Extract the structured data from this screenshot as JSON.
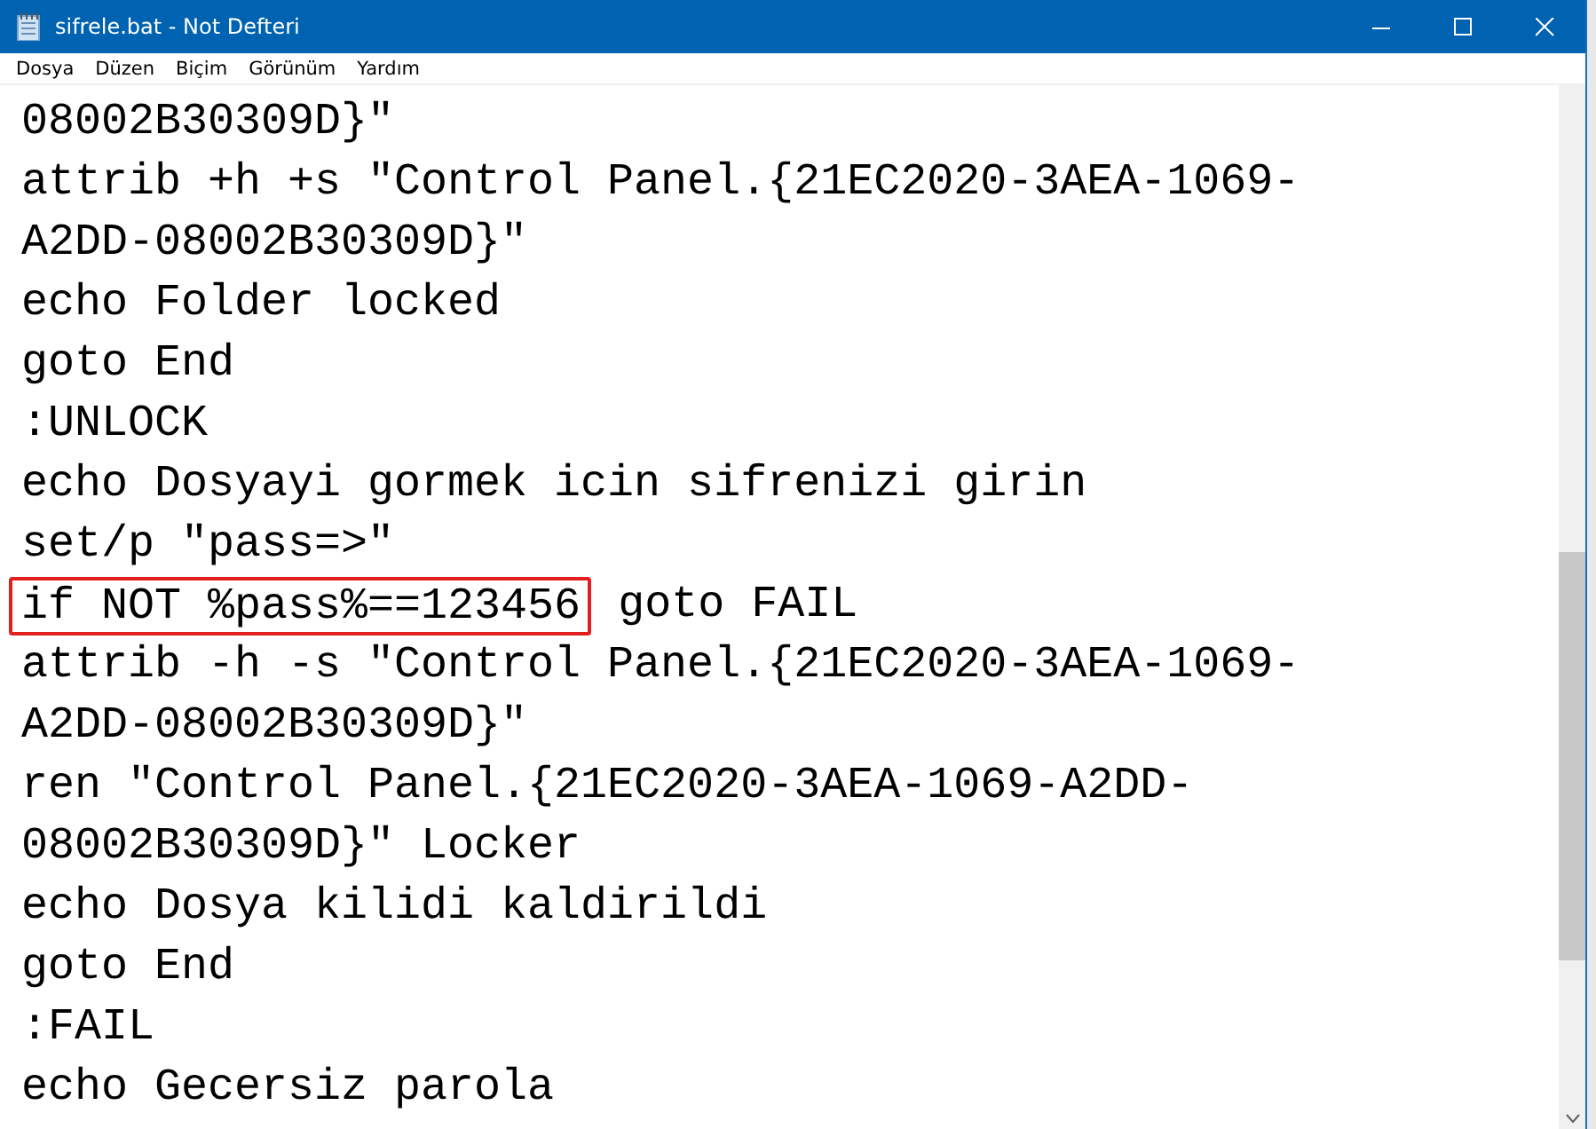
{
  "window": {
    "title": "sifrele.bat - Not Defteri"
  },
  "menu": [
    "Dosya",
    "Düzen",
    "Biçim",
    "Görünüm",
    "Yardım"
  ],
  "editor": {
    "lines": [
      {
        "text": "08002B30309D}\""
      },
      {
        "text": "attrib +h +s \"Control Panel.{21EC2020-3AEA-1069-"
      },
      {
        "text": "A2DD-08002B30309D}\""
      },
      {
        "text": "echo Folder locked"
      },
      {
        "text": "goto End"
      },
      {
        "text": ":UNLOCK"
      },
      {
        "text": "echo Dosyayi gormek icin sifrenizi girin"
      },
      {
        "text": "set/p \"pass=>\""
      },
      {
        "highlight": "if NOT %pass%==123456",
        "text": " goto FAIL"
      },
      {
        "text": "attrib -h -s \"Control Panel.{21EC2020-3AEA-1069-"
      },
      {
        "text": "A2DD-08002B30309D}\""
      },
      {
        "text": "ren \"Control Panel.{21EC2020-3AEA-1069-A2DD-"
      },
      {
        "text": "08002B30309D}\" Locker"
      },
      {
        "text": "echo Dosya kilidi kaldirildi"
      },
      {
        "text": "goto End"
      },
      {
        "text": ":FAIL"
      },
      {
        "text": "echo Gecersiz parola"
      }
    ]
  }
}
